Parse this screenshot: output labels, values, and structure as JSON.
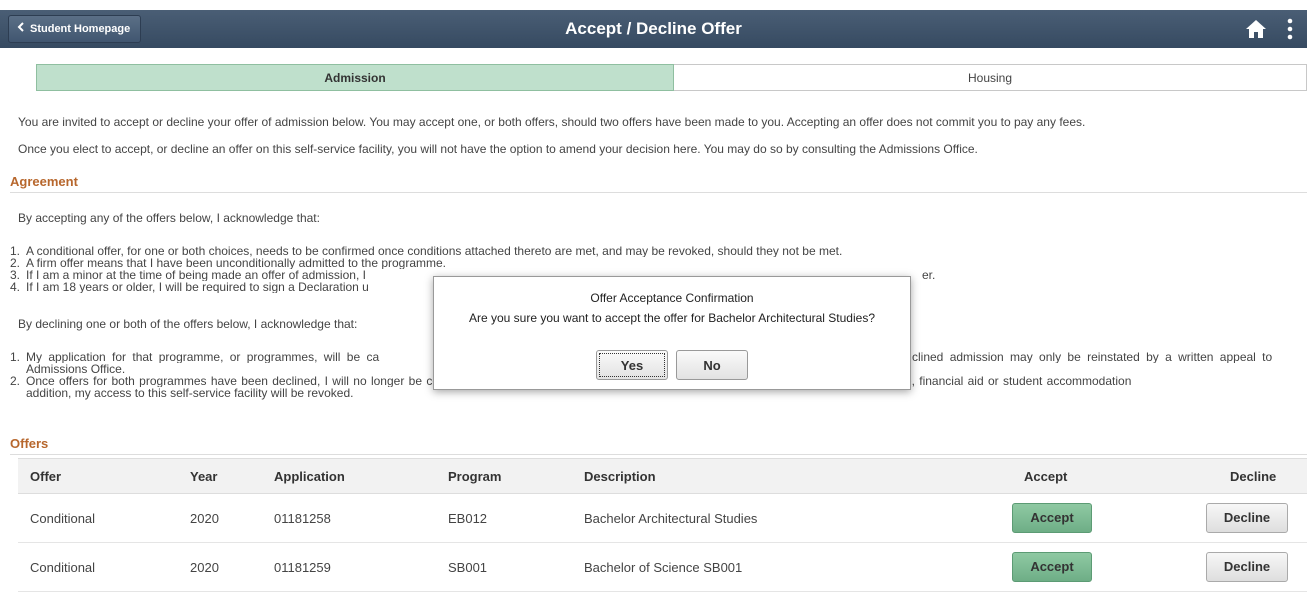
{
  "header": {
    "back_label": "Student Homepage",
    "title": "Accept / Decline Offer",
    "home_icon": "home-icon",
    "menu_icon": "vertical-dots-icon"
  },
  "tabs": [
    {
      "label": "Admission",
      "active": true
    },
    {
      "label": "Housing",
      "active": false
    }
  ],
  "intro": {
    "line1": "You are invited to accept or decline your offer of admission below. You may accept one, or both offers, should two offers have been made to you. Accepting an offer does not commit you to pay any fees.",
    "line2": "Once you elect to accept, or decline an offer on this self-service facility, you will not have the option to amend your decision here. You may do so by consulting the Admissions Office."
  },
  "agreement": {
    "heading": "Agreement",
    "accept_intro": "By accepting any of the offers below, I acknowledge that:",
    "accept_items": [
      "A conditional offer, for one or both choices, needs to be confirmed once conditions attached thereto are met, and may be revoked, should they not be met.",
      "A firm offer means that I have been unconditionally admitted to the programme.",
      "If I am a minor at the time of being made an offer of admission, I",
      "If I am 18 years or older, I will be required to sign a Declaration u"
    ],
    "accept_item3_tail": "er.",
    "decline_intro": "By declining one or both of the offers below, I acknowledge that:",
    "decline_items": [
      {
        "a": "My application for that programme, or programmes, will be ca",
        "b": "clined admission may only be reinstated by a written appeal to",
        "cont": "Admissions Office."
      },
      {
        "a": "Once offers for both programmes have been declined, I will no longer be considered for admission to any programme, nor for an award of an entrance scholarship, financial aid or student accommodation",
        "b": "",
        "cont": "addition, my access to this self-service facility will be revoked."
      }
    ]
  },
  "offers": {
    "heading": "Offers",
    "columns": [
      "Offer",
      "Year",
      "Application",
      "Program",
      "Description",
      "Accept",
      "Decline"
    ],
    "rows": [
      {
        "offer": "Conditional",
        "year": "2020",
        "application": "01181258",
        "program": "EB012",
        "description": "Bachelor Architectural Studies",
        "accept": "Accept",
        "decline": "Decline"
      },
      {
        "offer": "Conditional",
        "year": "2020",
        "application": "01181259",
        "program": "SB001",
        "description": "Bachelor of Science SB001",
        "accept": "Accept",
        "decline": "Decline"
      }
    ]
  },
  "modal": {
    "title": "Offer Acceptance Confirmation",
    "message": "Are you sure you want to accept the offer for Bachelor Architectural Studies?",
    "yes_label": "Yes",
    "no_label": "No"
  },
  "colors": {
    "header_bg": "#3e5269",
    "active_tab": "#bfe0cc",
    "section_heading": "#b7672d",
    "accept_button": "#7ab990"
  }
}
